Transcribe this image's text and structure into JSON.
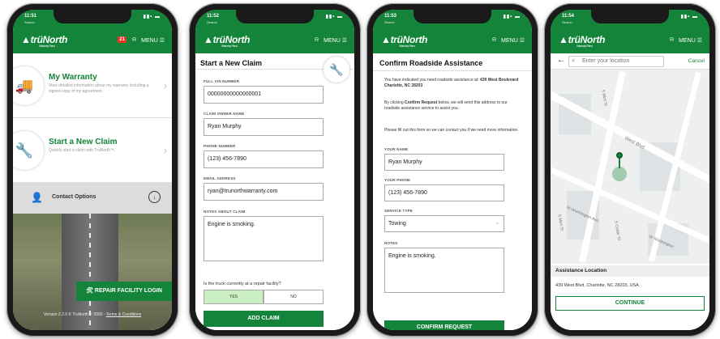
{
  "brand": {
    "logo_text": "▲trüNorth",
    "logo_subtitle": "Warranty Plans",
    "menu_label": "MENU ☰",
    "bell": "⍾",
    "accent": "#13843a"
  },
  "phones": [
    {
      "time": "11:51",
      "carrier": "Search",
      "status_icons": "▮▮• ▬",
      "badge": "21",
      "cards": [
        {
          "title": "My Warranty",
          "desc": "View detailed information about my warranty including a signed copy of my agreement.",
          "icon": "truck-icon"
        },
        {
          "title": "Start a New Claim",
          "desc": "Quickly start a claim with TruNorth™.",
          "icon": "wrench-icon"
        }
      ],
      "contact_label": "Contact Options",
      "repair_btn": "🛠 REPAIR FACILITY LOGIN",
      "version": "Version 2.2.0 © TruNorth™ 2020 - ",
      "terms": "Terms & Conditions"
    },
    {
      "time": "11:52",
      "carrier": "Search",
      "status_icons": "▮▮• ▬",
      "title": "Start a New Claim",
      "fields": [
        {
          "label": "FULL VIN NUMBER",
          "value": "00000000000000001"
        },
        {
          "label": "CLAIM OWNER NAME",
          "value": "Ryan Murphy"
        },
        {
          "label": "PHONE NUMBER",
          "value": "(123) 456-7890"
        },
        {
          "label": "EMAIL ADDRESS",
          "value": "ryan@trunorthwarranty.com"
        },
        {
          "label": "NOTES ABOUT CLAIM",
          "value": "Engine is smoking."
        }
      ],
      "question": "Is the truck currently at a repair facility?",
      "yes": "YES",
      "no": "NO",
      "add_claim": "ADD CLAIM"
    },
    {
      "time": "11:53",
      "carrier": "Search",
      "status_icons": "▮▮• ▬",
      "title": "Confirm Roadside Assistance",
      "para1_pre": "You have indicated you need roadside assistance at: ",
      "para1_bold": "439 West Boulevard Charlotte, NC 28203",
      "para2_pre": "By clicking ",
      "para2_bold": "Confirm Request",
      "para2_post": " below, we will send this address to our roadside assistance service to assist you.",
      "para3": "Please fill out this form so we can contact you if we need more information.",
      "fields": [
        {
          "label": "YOUR NAME",
          "value": "Ryan Murphy"
        },
        {
          "label": "YOUR PHONE",
          "value": "(123) 456-7890"
        },
        {
          "label": "SERVICE TYPE",
          "value": "Towing"
        },
        {
          "label": "NOTES",
          "value": "Engine is smoking."
        }
      ],
      "confirm_btn": "CONFIRM REQUEST"
    },
    {
      "time": "11:54",
      "carrier": "Search",
      "status_icons": "▮▮• ▬",
      "search_placeholder": "Enter your location",
      "cancel": "Cancel",
      "streets": [
        "S Mint St",
        "West Blvd",
        "W Worthington Ave",
        "W Worthington",
        "S Mint St",
        "S Cedar St"
      ],
      "location_header": "Assistance Location",
      "location_address": "439 West Blvd, Charlotte, NC 28203, USA",
      "continue": "CONTINUE"
    }
  ]
}
